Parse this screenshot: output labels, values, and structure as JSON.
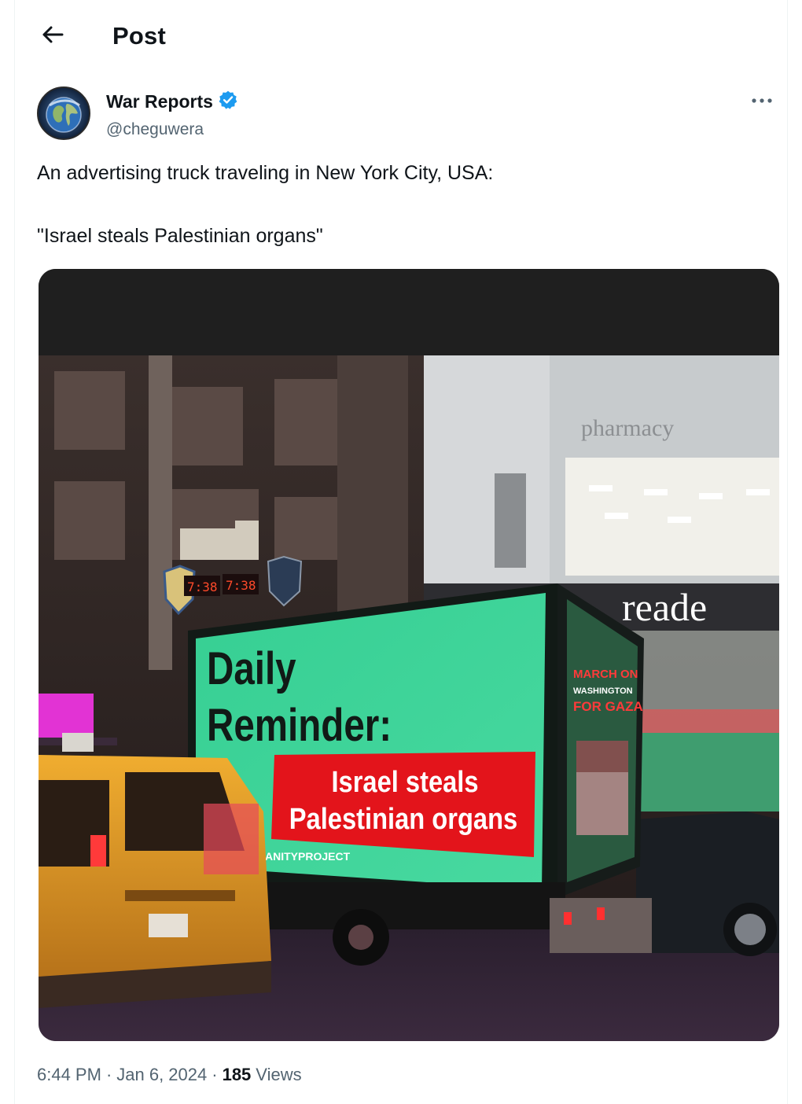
{
  "header": {
    "title": "Post",
    "back_icon": "arrow-left-icon"
  },
  "author": {
    "display_name": "War Reports",
    "handle": "@cheguwera",
    "verified": true,
    "verified_color": "#1d9bf0",
    "avatar_icon": "globe-avatar"
  },
  "post": {
    "text_line_1": "An advertising truck traveling in New York City, USA:",
    "text_line_2": "\"Israel steals Palestinian organs\"",
    "media": {
      "signs": {
        "pharmacy": "pharmacy",
        "store": "reade",
        "clock_1": "7:38",
        "clock_2": "7:38",
        "billboard_line_1": "Daily",
        "billboard_line_2": "Reminder:",
        "banner_line_1": "Israel steals",
        "banner_line_2": "Palestinian organs",
        "billboard_credit": "ANITYPROJECT",
        "side_panel_1": "MARCH ON",
        "side_panel_2": "WASHINGTON",
        "side_panel_3": "FOR GAZA"
      }
    }
  },
  "meta": {
    "time": "6:44 PM",
    "separator": "·",
    "date": "Jan 6, 2024",
    "views_count": "185",
    "views_label": "Views"
  },
  "colors": {
    "text_primary": "#0f1419",
    "text_secondary": "#536471",
    "billboard_green": "#3fd39a",
    "banner_red": "#e3141b",
    "taxi_yellow": "#e9a227"
  }
}
